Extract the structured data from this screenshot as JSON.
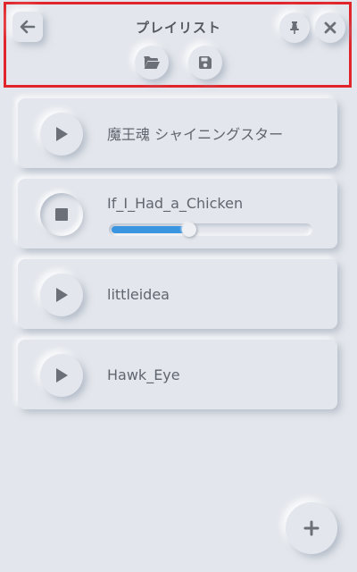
{
  "header": {
    "title": "プレイリスト"
  },
  "icons": {
    "back": "arrow-left-icon",
    "pin": "pin-icon",
    "close": "close-icon",
    "open": "folder-open-icon",
    "save": "floppy-disk-icon",
    "play": "play-icon",
    "stop": "stop-icon",
    "add": "plus-icon"
  },
  "playlist": [
    {
      "title": "魔王魂 シャイニングスター",
      "state": "stopped"
    },
    {
      "title": "If_I_Had_a_Chicken",
      "state": "playing",
      "progress": 0.39
    },
    {
      "title": "littleidea",
      "state": "stopped"
    },
    {
      "title": "Hawk_Eye",
      "state": "stopped"
    }
  ],
  "colors": {
    "background": "#e3e6ec",
    "accent": "#3a94e0",
    "highlight_border": "#e0262b",
    "icon": "#6b7078"
  }
}
